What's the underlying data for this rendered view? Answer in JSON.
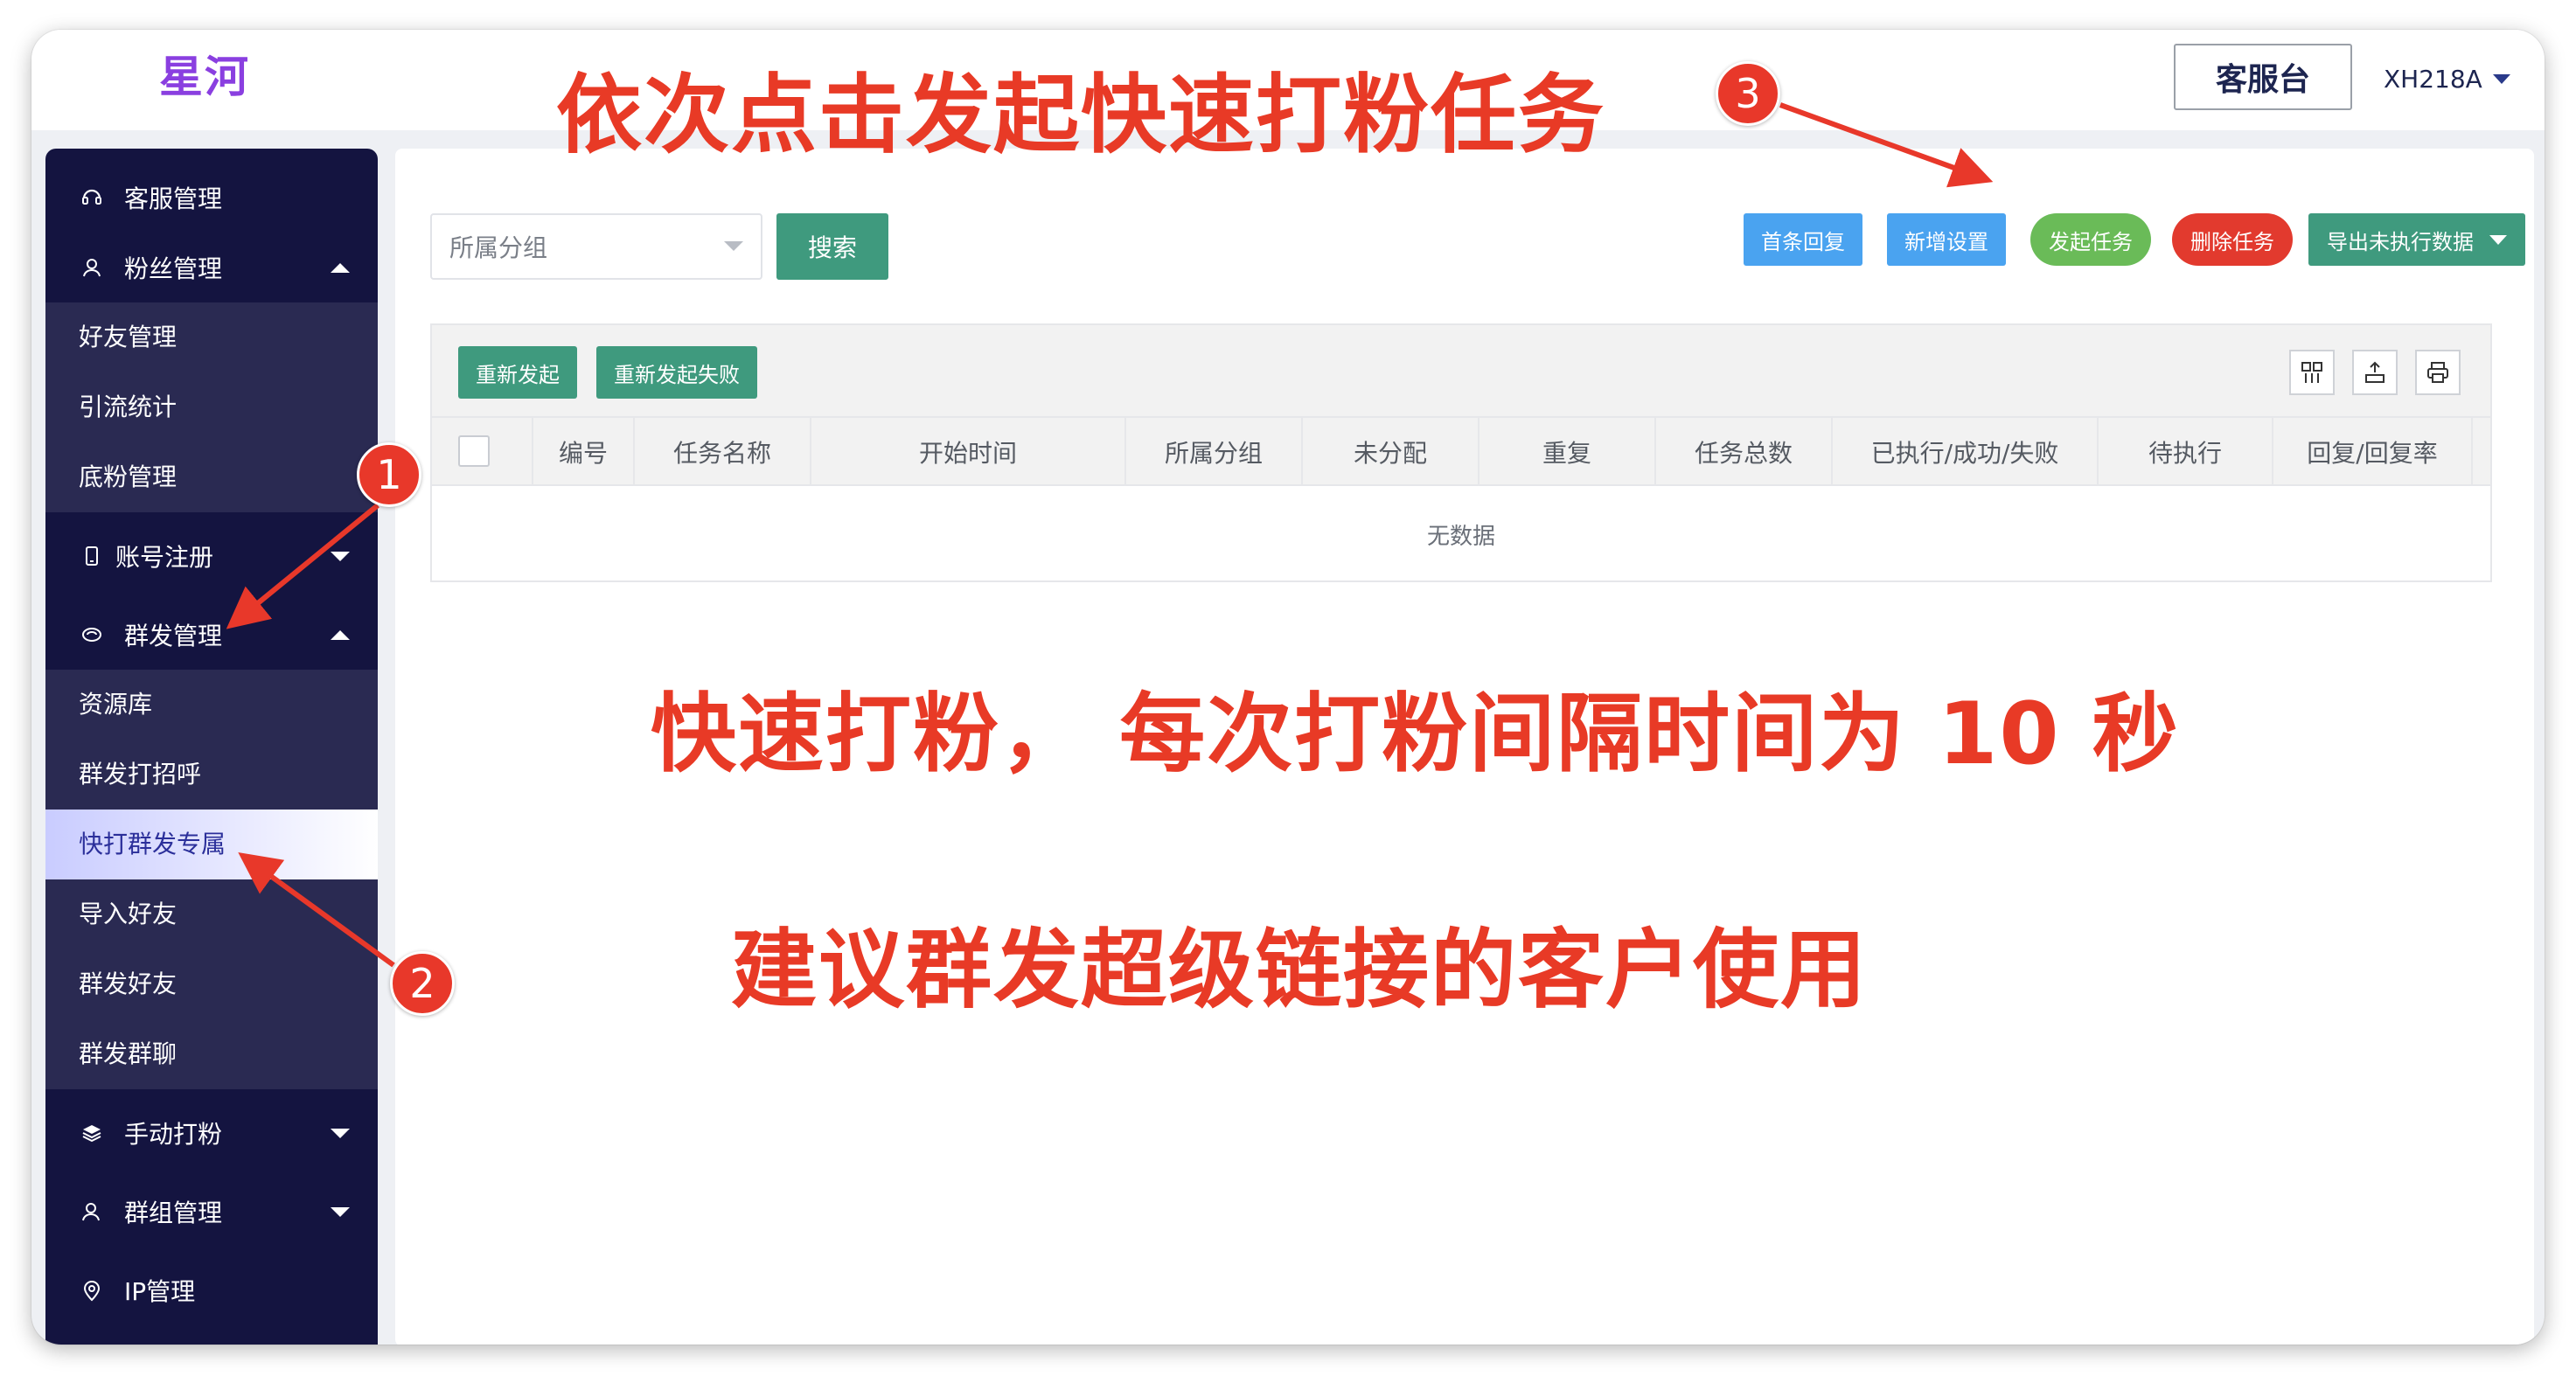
{
  "header": {
    "brand": "星河",
    "service_button": "客服台",
    "user_label": "XH218A"
  },
  "sidebar": {
    "sections": [
      {
        "label": "客服管理",
        "icon": "headset-icon"
      },
      {
        "label": "粉丝管理",
        "icon": "user-icon",
        "expanded": true
      },
      {
        "label": "账号注册",
        "icon": "phone-icon",
        "expanded": false
      },
      {
        "label": "群发管理",
        "icon": "chat-icon",
        "expanded": true
      },
      {
        "label": "手动打粉",
        "icon": "layers-icon",
        "expanded": false
      },
      {
        "label": "群组管理",
        "icon": "group-icon",
        "expanded": false
      },
      {
        "label": "IP管理",
        "icon": "location-pin-icon"
      }
    ],
    "fans_sub": [
      "好友管理",
      "引流统计",
      "底粉管理"
    ],
    "mass_sub": [
      "资源库",
      "群发打招呼",
      "快打群发专属",
      "导入好友",
      "群发好友",
      "群发群聊"
    ],
    "active_item": "快打群发专属"
  },
  "filters": {
    "group_placeholder": "所属分组",
    "search_label": "搜索"
  },
  "toolbar": {
    "first_reply": "首条回复",
    "new_setting": "新增设置",
    "launch_task": "发起任务",
    "delete_task": "删除任务",
    "export_label": "导出未执行数据"
  },
  "table": {
    "relaunch": "重新发起",
    "relaunch_failed": "重新发起失败",
    "columns": [
      "编号",
      "任务名称",
      "开始时间",
      "所属分组",
      "未分配",
      "重复",
      "任务总数",
      "已执行/成功/失败",
      "待执行",
      "回复/回复率"
    ],
    "empty_text": "无数据"
  },
  "annotations": {
    "top": "依次点击发起快速打粉任务",
    "middle": "快速打粉， 每次打粉间隔时间为 10 秒",
    "bottom": "建议群发超级链接的客户使用",
    "badges": [
      "1",
      "2",
      "3"
    ]
  },
  "colors": {
    "sidebar": "#141440",
    "sidebar_sub": "#2a2a52",
    "brand": "#8a3fe0",
    "primary_green": "#3f9a7e",
    "blue": "#4aa3f0",
    "launch_green": "#6abb58",
    "danger": "#e23a2e",
    "annotation_red": "#e83a26"
  }
}
